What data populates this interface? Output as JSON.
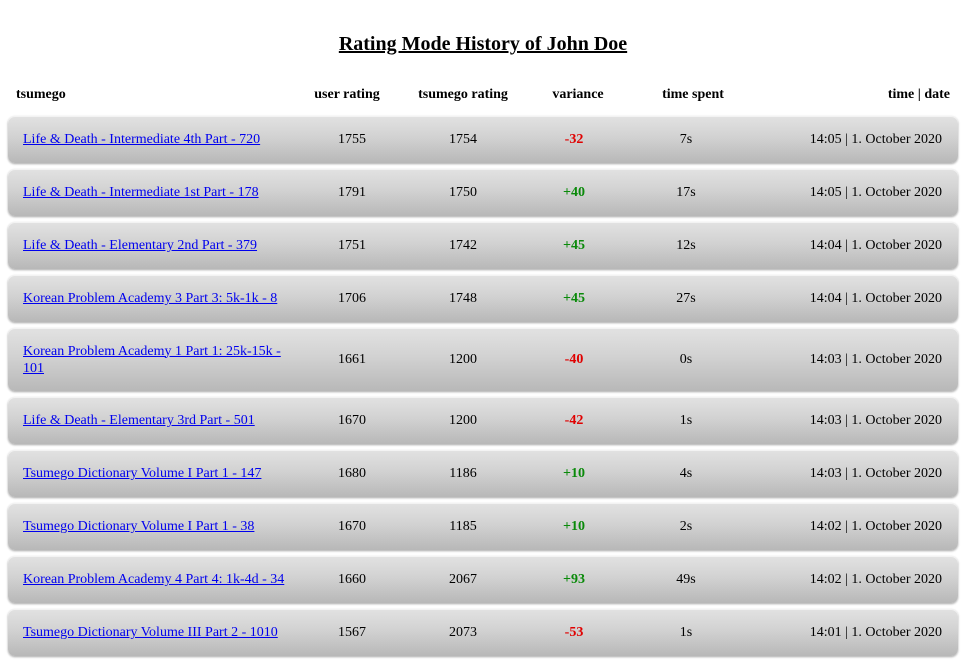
{
  "page": {
    "title": "Rating Mode History of John Doe"
  },
  "columns": {
    "tsumego": "tsumego",
    "user_rating": "user rating",
    "tsumego_rating": "tsumego rating",
    "variance": "variance",
    "time_spent": "time spent",
    "time_date": "time | date"
  },
  "colors": {
    "positive": "#0a8a0a",
    "negative": "#e00000",
    "link": "#0000ee"
  },
  "rows": [
    {
      "name": "Life & Death - Intermediate 4th Part - 720",
      "user_rating": "1755",
      "tsumego_rating": "1754",
      "variance": "-32",
      "sign": "neg",
      "time_spent": "7s",
      "time_date": "14:05 | 1. October 2020"
    },
    {
      "name": "Life & Death - Intermediate 1st Part - 178",
      "user_rating": "1791",
      "tsumego_rating": "1750",
      "variance": "+40",
      "sign": "pos",
      "time_spent": "17s",
      "time_date": "14:05 | 1. October 2020"
    },
    {
      "name": "Life & Death - Elementary 2nd Part - 379",
      "user_rating": "1751",
      "tsumego_rating": "1742",
      "variance": "+45",
      "sign": "pos",
      "time_spent": "12s",
      "time_date": "14:04 | 1. October 2020"
    },
    {
      "name": "Korean Problem Academy 3 Part 3: 5k-1k - 8",
      "user_rating": "1706",
      "tsumego_rating": "1748",
      "variance": "+45",
      "sign": "pos",
      "time_spent": "27s",
      "time_date": "14:04 | 1. October 2020"
    },
    {
      "name": "Korean Problem Academy 1 Part 1: 25k-15k - 101",
      "user_rating": "1661",
      "tsumego_rating": "1200",
      "variance": "-40",
      "sign": "neg",
      "time_spent": "0s",
      "time_date": "14:03 | 1. October 2020",
      "tall": true
    },
    {
      "name": "Life & Death - Elementary 3rd Part - 501",
      "user_rating": "1670",
      "tsumego_rating": "1200",
      "variance": "-42",
      "sign": "neg",
      "time_spent": "1s",
      "time_date": "14:03 | 1. October 2020"
    },
    {
      "name": "Tsumego Dictionary Volume I Part 1 - 147",
      "user_rating": "1680",
      "tsumego_rating": "1186",
      "variance": "+10",
      "sign": "pos",
      "time_spent": "4s",
      "time_date": "14:03 | 1. October 2020"
    },
    {
      "name": "Tsumego Dictionary Volume I Part 1 - 38",
      "user_rating": "1670",
      "tsumego_rating": "1185",
      "variance": "+10",
      "sign": "pos",
      "time_spent": "2s",
      "time_date": "14:02 | 1. October 2020"
    },
    {
      "name": "Korean Problem Academy 4 Part 4: 1k-4d - 34",
      "user_rating": "1660",
      "tsumego_rating": "2067",
      "variance": "+93",
      "sign": "pos",
      "time_spent": "49s",
      "time_date": "14:02 | 1. October 2020"
    },
    {
      "name": "Tsumego Dictionary Volume III Part 2 - 1010",
      "user_rating": "1567",
      "tsumego_rating": "2073",
      "variance": "-53",
      "sign": "neg",
      "time_spent": "1s",
      "time_date": "14:01 | 1. October 2020"
    }
  ]
}
